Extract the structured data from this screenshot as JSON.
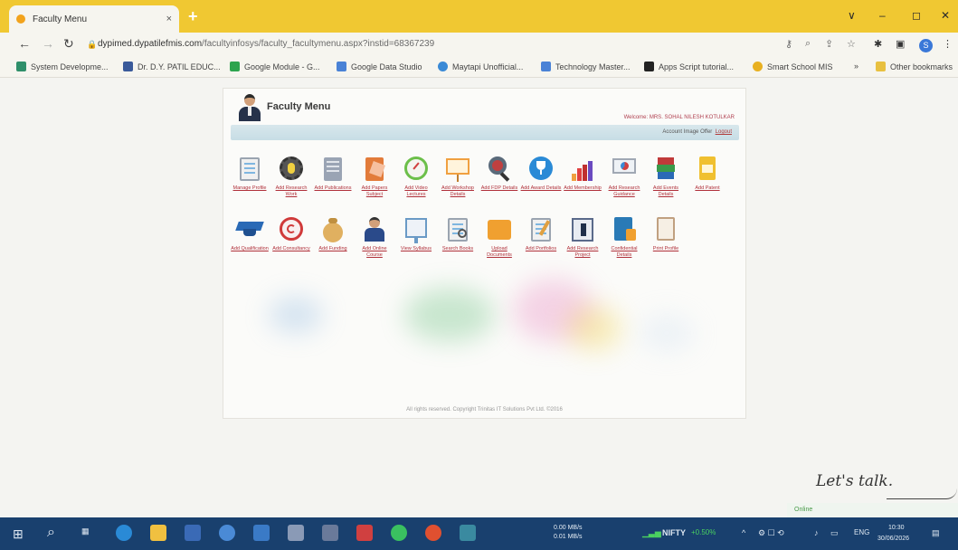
{
  "browser": {
    "tab_title": "Faculty Menu",
    "tab_close": "×",
    "new_tab": "+",
    "url_host": "dypimed.dypatilefmis.com",
    "url_path": "/facultyinfosys/faculty_facultymenu.aspx?instid=68367239",
    "window_controls": [
      "∨",
      "–",
      "◻",
      "✕"
    ],
    "profile_initial": "S",
    "bookmarks": [
      {
        "label": "System Developme...",
        "color": "#2f8f6a"
      },
      {
        "label": "Dr. D.Y. PATIL EDUC...",
        "color": "#3a5a9a"
      },
      {
        "label": "Google Module - G...",
        "color": "#2da44e"
      },
      {
        "label": "Google Data Studio",
        "color": "#4a82d6"
      },
      {
        "label": "Maytapi Unofficial...",
        "color": "#3a8ad6"
      },
      {
        "label": "Technology Master...",
        "color": "#4a82d6"
      },
      {
        "label": "Apps Script tutorial...",
        "color": "#222222"
      },
      {
        "label": "Smart School MIS",
        "color": "#e8b020"
      }
    ],
    "bookmarks_more": "»",
    "other_bookmarks": "Other bookmarks"
  },
  "page": {
    "title": "Faculty Menu",
    "welcome": "Welcome: MRS. SOHAL NILESH KOTULKAR",
    "subbar_links": "Account   Image Offer",
    "logout": "Logout",
    "row1": [
      {
        "label": "Manage Profile",
        "icon": "profile-icon",
        "color": "#5b8fd6"
      },
      {
        "label": "Add Research Work",
        "icon": "gear-bulb-icon",
        "color": "#444444"
      },
      {
        "label": "Add Publications",
        "icon": "book-icon",
        "color": "#8a96a8"
      },
      {
        "label": "Add Papers Subject",
        "icon": "papers-icon",
        "color": "#e27b3a"
      },
      {
        "label": "Add Video Lectures",
        "icon": "gauge-icon",
        "color": "#6cbf4a"
      },
      {
        "label": "Add Workshop Details",
        "icon": "presentation-icon",
        "color": "#f0a040"
      },
      {
        "label": "Add FDP Details",
        "icon": "magnifier-icon",
        "color": "#c04040"
      },
      {
        "label": "Add Award Details",
        "icon": "trophy-icon",
        "color": "#2a8ad6"
      },
      {
        "label": "Add Membership",
        "icon": "bar-chart-icon",
        "color": "#e04040"
      },
      {
        "label": "Add Research Guidance",
        "icon": "board-icon",
        "color": "#d04040"
      },
      {
        "label": "Add Events Details",
        "icon": "books-icon",
        "color": "#3a9a4a"
      },
      {
        "label": "Add Patent",
        "icon": "document-icon",
        "color": "#f0c030"
      }
    ],
    "row2": [
      {
        "label": "Add Qualification",
        "icon": "graduation-cap-icon",
        "color": "#2a6ab6"
      },
      {
        "label": "Add Consultancy",
        "icon": "copyright-icon",
        "color": "#d03a3a"
      },
      {
        "label": "Add Funding",
        "icon": "money-bag-icon",
        "color": "#d8a040"
      },
      {
        "label": "Add Online Course",
        "icon": "teacher-icon",
        "color": "#2a4a8a"
      },
      {
        "label": "View Syllabus",
        "icon": "notebook-icon",
        "color": "#6a9ac6"
      },
      {
        "label": "Search Books",
        "icon": "search-doc-icon",
        "color": "#7a8aa0"
      },
      {
        "label": "Upload Documents",
        "icon": "folder-icon",
        "color": "#f0a030"
      },
      {
        "label": "Add Portfolios",
        "icon": "edit-doc-icon",
        "color": "#d0a060"
      },
      {
        "label": "Add Research Project",
        "icon": "project-icon",
        "color": "#5a6a8a"
      },
      {
        "label": "Confidential Details",
        "icon": "confidential-icon",
        "color": "#2a7ab6"
      },
      {
        "label": "Print Profile",
        "icon": "print-icon",
        "color": "#c0a080"
      }
    ],
    "copyright": "All rights reserved. Copyright Trinitas IT Solutions Pvt Ltd. ©2016"
  },
  "overlay": {
    "lets_talk": "Let's talk.",
    "online_status": "Online"
  },
  "taskbar": {
    "network_stats": [
      "0.00 MB/s",
      "0.01 MB/s"
    ],
    "stock_label": "NIFTY",
    "stock_change": "+0.50%",
    "lang": "ENG",
    "time": "10:30",
    "date": "30/06/2026"
  }
}
